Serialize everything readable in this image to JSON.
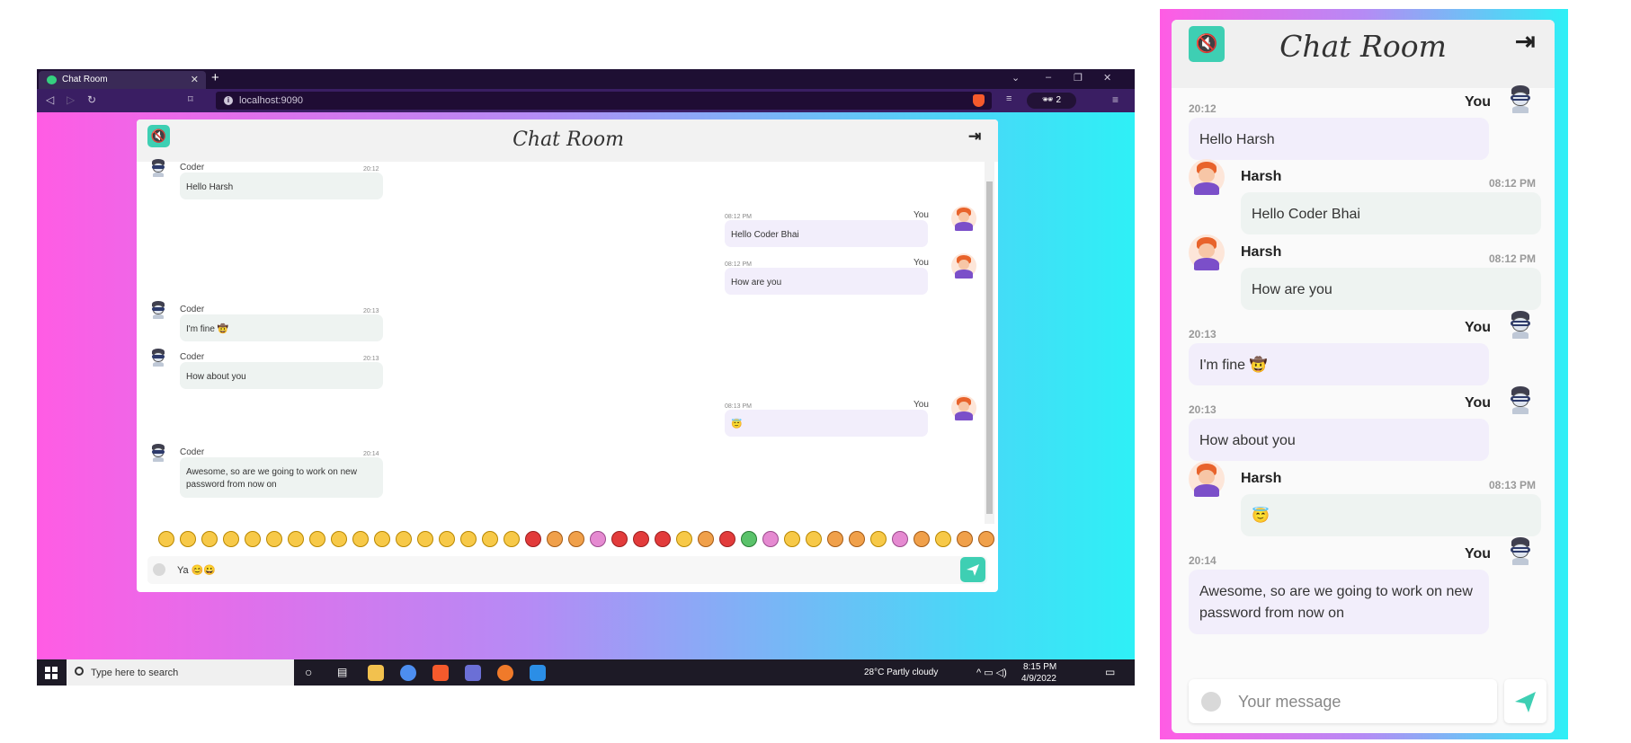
{
  "browser": {
    "tab_title": "Chat Room",
    "new_tab": "+",
    "url": "localhost:9090",
    "shields_count": "2",
    "window_controls": [
      "⌄",
      "–",
      "❐",
      "✕"
    ]
  },
  "app": {
    "title": "Chat Room",
    "mute_icon": "volume-mute-icon",
    "logout_icon": "logout-icon",
    "send_icon": "send-icon"
  },
  "desktop_messages": [
    {
      "sender": "Coder",
      "time": "20:12",
      "text": "Hello Harsh",
      "side": "left"
    },
    {
      "sender": "You",
      "time": "08:12 PM",
      "text": "Hello Coder Bhai",
      "side": "right"
    },
    {
      "sender": "You",
      "time": "08:12 PM",
      "text": "How are you",
      "side": "right"
    },
    {
      "sender": "Coder",
      "time": "20:13",
      "text": "I'm fine 🤠",
      "side": "left"
    },
    {
      "sender": "Coder",
      "time": "20:13",
      "text": "How about you",
      "side": "left"
    },
    {
      "sender": "You",
      "time": "08:13 PM",
      "text": "😇",
      "side": "right"
    },
    {
      "sender": "Coder",
      "time": "20:14",
      "text": "Awesome, so are we going to work on new password from now on",
      "side": "left"
    }
  ],
  "desktop_input": {
    "value": "Ya 😊😀"
  },
  "mobile_messages": [
    {
      "sender": "You",
      "time": "20:12",
      "text": "Hello Harsh"
    },
    {
      "sender": "Harsh",
      "time": "08:12 PM",
      "text": "Hello Coder Bhai"
    },
    {
      "sender": "Harsh",
      "time": "08:12 PM",
      "text": "How are you"
    },
    {
      "sender": "You",
      "time": "20:13",
      "text": "I'm fine 🤠"
    },
    {
      "sender": "You",
      "time": "20:13",
      "text": "How about you"
    },
    {
      "sender": "Harsh",
      "time": "08:13 PM",
      "text": "😇"
    },
    {
      "sender": "You",
      "time": "20:14",
      "text": "Awesome, so are we going to work on new password from now on"
    }
  ],
  "mobile_input": {
    "placeholder": "Your message"
  },
  "taskbar": {
    "search_placeholder": "Type here to search",
    "weather": "28°C  Partly cloudy",
    "time": "8:15 PM",
    "date": "4/9/2022"
  },
  "colors": {
    "accent": "#3ecfb3",
    "bubble_in": "#eef3f1",
    "bubble_out": "#f2eefb"
  }
}
